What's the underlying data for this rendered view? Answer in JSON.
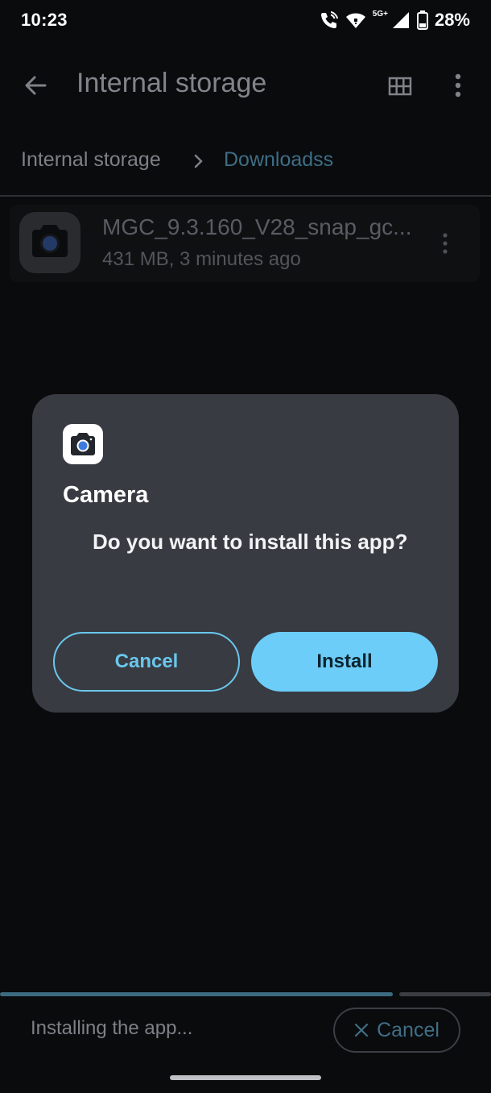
{
  "status_bar": {
    "time": "10:23",
    "network_label": "5G+",
    "battery": "28%"
  },
  "app_bar": {
    "title": "Internal storage",
    "icons": [
      "back-arrow-icon",
      "grid-view-icon",
      "more-vert-icon"
    ]
  },
  "breadcrumb": {
    "root": "Internal storage",
    "current": "Downloadss"
  },
  "file": {
    "name": "MGC_9.3.160_V28_snap_gc...",
    "meta": "431 MB, 3 minutes ago",
    "icon": "camera-app-icon"
  },
  "dialog": {
    "app_name": "Camera",
    "message": "Do you want to install this app?",
    "cancel_label": "Cancel",
    "install_label": "Install"
  },
  "footer": {
    "status_text": "Installing the app...",
    "cancel_label": "Cancel",
    "progress": 0.8
  },
  "colors": {
    "accent": "#6ccdf8",
    "dialog_bg": "#383b42",
    "background": "#0a0b0d"
  }
}
